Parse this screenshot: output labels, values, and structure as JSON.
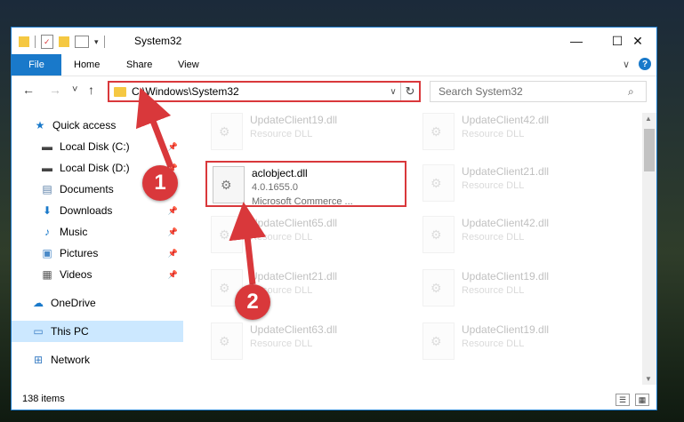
{
  "window": {
    "title": "System32",
    "controls": {
      "minimize": "—",
      "maximize": "☐",
      "close": "✕"
    }
  },
  "ribbon": {
    "file": "File",
    "tabs": [
      "Home",
      "Share",
      "View"
    ],
    "expand": "∨",
    "help": "?"
  },
  "nav": {
    "back": "←",
    "forward": "→",
    "recent": "˅",
    "up": "↑",
    "address": "C:\\Windows\\System32",
    "search_placeholder": "Search System32"
  },
  "sidebar": {
    "items": [
      {
        "label": "Quick access",
        "icon": "star-icon",
        "glyph": "★",
        "color": "#1979ca",
        "pinned": false
      },
      {
        "label": "Local Disk (C:)",
        "icon": "drive-icon",
        "glyph": "▬",
        "color": "#444444",
        "pinned": true
      },
      {
        "label": "Local Disk (D:)",
        "icon": "drive-icon",
        "glyph": "▬",
        "color": "#444444",
        "pinned": true
      },
      {
        "label": "Documents",
        "icon": "documents-icon",
        "glyph": "▤",
        "color": "#5a7fa8",
        "pinned": true
      },
      {
        "label": "Downloads",
        "icon": "download-icon",
        "glyph": "⬇",
        "color": "#1979ca",
        "pinned": true
      },
      {
        "label": "Music",
        "icon": "music-icon",
        "glyph": "♪",
        "color": "#1979ca",
        "pinned": true
      },
      {
        "label": "Pictures",
        "icon": "pictures-icon",
        "glyph": "▣",
        "color": "#4a8ac8",
        "pinned": true
      },
      {
        "label": "Videos",
        "icon": "videos-icon",
        "glyph": "▦",
        "color": "#555555",
        "pinned": true
      },
      {
        "label": "OneDrive",
        "icon": "cloud-icon",
        "glyph": "☁",
        "color": "#1979ca",
        "pinned": false
      },
      {
        "label": "This PC",
        "icon": "computer-icon",
        "glyph": "▭",
        "color": "#3a7ec4",
        "pinned": false,
        "selected": true
      },
      {
        "label": "Network",
        "icon": "network-icon",
        "glyph": "⊞",
        "color": "#3a7ec4",
        "pinned": false
      }
    ]
  },
  "files": [
    {
      "name": "UpdateClient19.dll",
      "type": "Resource DLL",
      "faded": true
    },
    {
      "name": "UpdateClient42.dll",
      "type": "Resource DLL",
      "faded": true
    },
    {
      "name": "aclobject.dll",
      "version": "4.0.1655.0",
      "type": "Microsoft Commerce ...",
      "highlight": true
    },
    {
      "name": "UpdateClient21.dll",
      "type": "Resource DLL",
      "faded": true
    },
    {
      "name": "UpdateClient65.dll",
      "type": "Resource DLL",
      "faded": true
    },
    {
      "name": "UpdateClient42.dll",
      "type": "Resource DLL",
      "faded": true
    },
    {
      "name": "UpdateClient21.dll",
      "type": "Resource DLL",
      "faded": true
    },
    {
      "name": "UpdateClient19.dll",
      "type": "Resource DLL",
      "faded": true
    },
    {
      "name": "UpdateClient63.dll",
      "type": "Resource DLL",
      "faded": true
    },
    {
      "name": "UpdateClient19.dll",
      "type": "Resource DLL",
      "faded": true
    }
  ],
  "status": {
    "count": "138 items"
  },
  "annotations": {
    "step1": "1",
    "step2": "2",
    "color": "#d9383b"
  }
}
